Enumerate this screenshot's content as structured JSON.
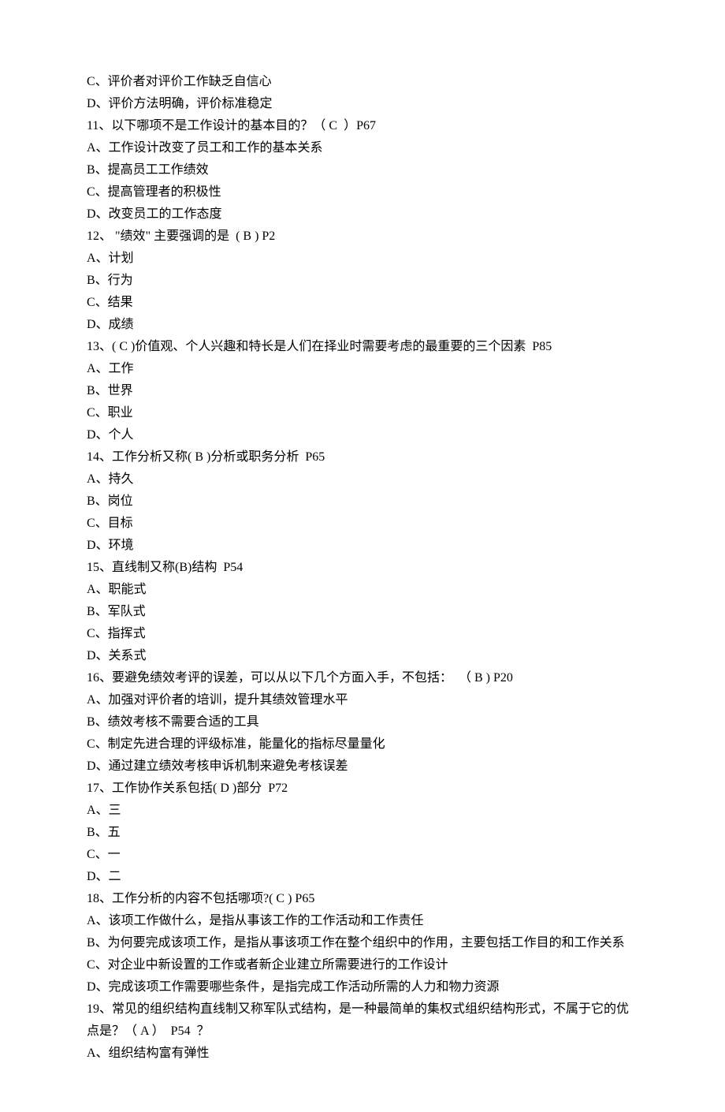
{
  "lines": [
    "C、评价者对评价工作缺乏自信心",
    "D、评价方法明确，评价标准稳定",
    "11、以下哪项不是工作设计的基本目的？（ C  ）P67",
    "A、工作设计改变了员工和工作的基本关系",
    "B、提高员工工作绩效",
    "C、提高管理者的积极性",
    "D、改变员工的工作态度",
    "12、 \"绩效\" 主要强调的是  ( B ) P2",
    "A、计划",
    "B、行为",
    "C、结果",
    "D、成绩",
    "13、( C )价值观、个人兴趣和特长是人们在择业时需要考虑的最重要的三个因素  P85",
    "A、工作",
    "B、世界",
    "C、职业",
    "D、个人",
    "14、工作分析又称( B )分析或职务分析  P65",
    "A、持久",
    "B、岗位",
    "C、目标",
    "D、环境",
    "15、直线制又称(B)结构  P54",
    "A、职能式",
    "B、军队式",
    "C、指挥式",
    "D、关系式",
    "16、要避免绩效考评的误差，可以从以下几个方面入手，不包括：  （ B ) P20",
    "A、加强对评价者的培训，提升其绩效管理水平",
    "B、绩效考核不需要合适的工具",
    "C、制定先进合理的评级标准，能量化的指标尽量量化",
    "D、通过建立绩效考核申诉机制来避免考核误差",
    "17、工作协作关系包括( D )部分  P72",
    "A、三",
    "B、五",
    "C、一",
    "D、二",
    "18、工作分析的内容不包括哪项?( C ) P65",
    "A、该项工作做什么，是指从事该工作的工作活动和工作责任",
    "B、为何要完成该项工作，是指从事该项工作在整个组织中的作用，主要包括工作目的和工作关系",
    "C、对企业中新设置的工作或者新企业建立所需要进行的工作设计",
    "D、完成该项工作需要哪些条件，是指完成工作活动所需的人力和物力资源",
    "19、常见的组织结构直线制又称军队式结构，是一种最简单的集权式组织结构形式，不属于它的优点是？（ A ）  P54  ？",
    "A、组织结构富有弹性"
  ]
}
